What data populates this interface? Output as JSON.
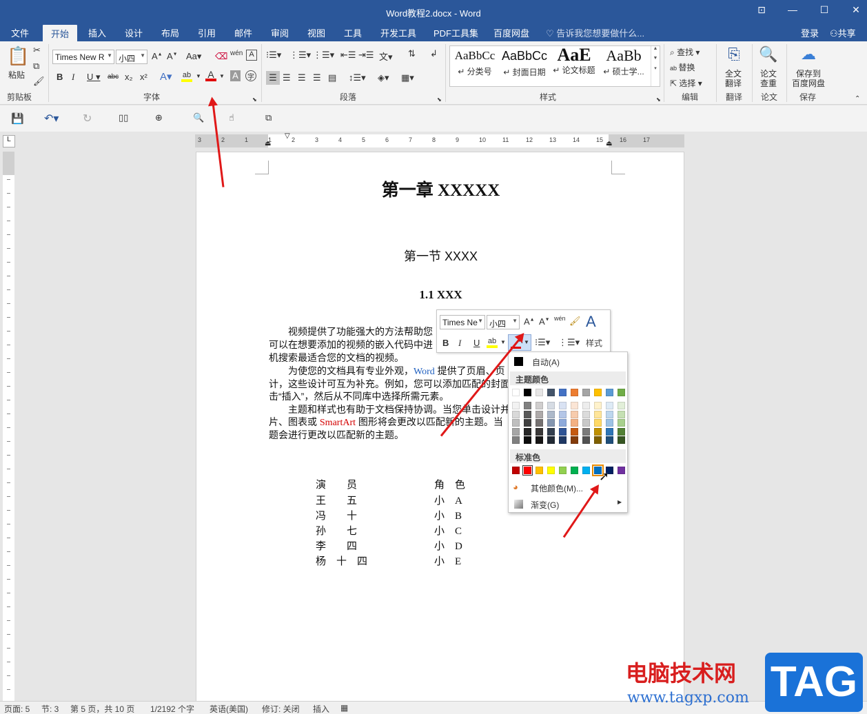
{
  "window": {
    "title": "Word教程2.docx - Word"
  },
  "tabs": [
    "文件",
    "开始",
    "插入",
    "设计",
    "布局",
    "引用",
    "邮件",
    "审阅",
    "视图",
    "工具",
    "开发工具",
    "PDF工具集",
    "百度网盘"
  ],
  "tell_me": "告诉我您想要做什么...",
  "account": {
    "login": "登录",
    "share": "共享"
  },
  "ribbon": {
    "clipboard": {
      "paste": "粘贴",
      "group": "剪贴板"
    },
    "font": {
      "name": "Times New R",
      "size": "小四",
      "group": "字体"
    },
    "paragraph": {
      "group": "段落"
    },
    "styles": {
      "group": "样式",
      "items": [
        {
          "preview": "AaBbCc",
          "label": "↵ 分类号"
        },
        {
          "preview": "AaBbCc",
          "label": "↵ 封面日期"
        },
        {
          "preview": "AaE",
          "label": "↵ 论文标题"
        },
        {
          "preview": "AaBb",
          "label": "↵ 硕士学..."
        }
      ]
    },
    "editing": {
      "find": "查找",
      "replace": "替换",
      "select": "选择",
      "group": "编辑"
    },
    "translate": {
      "btn1": "全文",
      "btn2": "翻译",
      "group": "翻译"
    },
    "paper": {
      "btn1": "论文",
      "btn2": "查重",
      "group": "论文"
    },
    "save": {
      "btn1": "保存到",
      "btn2": "百度网盘",
      "group": "保存"
    }
  },
  "ruler_numbers": [
    "3",
    "2",
    "1",
    "1",
    "2",
    "3",
    "4",
    "5",
    "6",
    "7",
    "8",
    "9",
    "10",
    "11",
    "12",
    "13",
    "14",
    "15",
    "16",
    "17"
  ],
  "document": {
    "chapter": "第一章  XXXXX",
    "section": "第一节  XXXX",
    "subsection": "1.1 XXX",
    "p1": [
      "视频提供了功能强大的方法帮助您",
      "可以在想要添加的视频的嵌入代码中进",
      "机搜索最适合您的文档的视频。"
    ],
    "p2_line1_a": "为使您的文档具有专业外观，",
    "p2_word": "Word",
    "p2_line1_b": " 提供了页眉、页",
    "p2_line2": "计，这些设计可互为补充。例如，您可以添加匹配的封面",
    "p2_line3": "击“插入”，然后从不同库中选择所需元素。",
    "p3_line1": "主题和样式也有助于文档保持协调。当您单击设计并",
    "p3_line2_a": "片、图表或 ",
    "p3_smartart": "SmartArt",
    "p3_line2_b": " 图形将会更改以匹配新的主题。当",
    "p3_line3": "题会进行更改以匹配新的主题。",
    "table": {
      "headers": [
        "演　　员",
        "角　色"
      ],
      "rows": [
        [
          "王　　五",
          "小　A"
        ],
        [
          "冯　　十",
          "小　B"
        ],
        [
          "孙　　七",
          "小　C"
        ],
        [
          "李　　四",
          "小　D"
        ],
        [
          "杨　十　四",
          "小　E"
        ]
      ]
    }
  },
  "mini_toolbar": {
    "font": "Times Ne",
    "size": "小四",
    "styles_label": "样式"
  },
  "color_menu": {
    "auto": "自动(A)",
    "theme_header": "主题颜色",
    "standard_header": "标准色",
    "more": "其他颜色(M)...",
    "gradient": "渐变(G)",
    "theme_top": [
      "#ffffff",
      "#000000",
      "#e7e6e6",
      "#44546a",
      "#4472c4",
      "#ed7d31",
      "#a5a5a5",
      "#ffc000",
      "#5b9bd5",
      "#70ad47"
    ],
    "theme_shades": [
      [
        "#f2f2f2",
        "#d9d9d9",
        "#bfbfbf",
        "#a6a6a6",
        "#808080"
      ],
      [
        "#808080",
        "#595959",
        "#404040",
        "#262626",
        "#0d0d0d"
      ],
      [
        "#d0cece",
        "#aeaaaa",
        "#757171",
        "#3a3838",
        "#171616"
      ],
      [
        "#d6dce4",
        "#adb9ca",
        "#8496b0",
        "#333f4f",
        "#222a35"
      ],
      [
        "#d9e2f3",
        "#b4c6e7",
        "#8eaadb",
        "#2f5496",
        "#1f3864"
      ],
      [
        "#fbe5d5",
        "#f7cbac",
        "#f4b183",
        "#c55a11",
        "#833c0b"
      ],
      [
        "#ededed",
        "#dbdbdb",
        "#c9c9c9",
        "#7b7b7b",
        "#525252"
      ],
      [
        "#fff2cc",
        "#ffe599",
        "#ffd965",
        "#bf9000",
        "#7f6000"
      ],
      [
        "#deebf6",
        "#bdd7ee",
        "#9dc3e5",
        "#2e75b5",
        "#1f4e79"
      ],
      [
        "#e2efd9",
        "#c5e0b3",
        "#a8d08d",
        "#538135",
        "#375623"
      ]
    ],
    "standard": [
      "#c00000",
      "#ff0000",
      "#ffc000",
      "#ffff00",
      "#92d050",
      "#00b050",
      "#00b0f0",
      "#0070c0",
      "#002060",
      "#7030a0"
    ]
  },
  "status": {
    "page": "页面: 5",
    "section": "节: 3",
    "pages": "第 5 页，共 10 页",
    "words": "1/2192 个字",
    "lang": "英语(美国)",
    "track": "修订: 关闭",
    "insert": "插入"
  },
  "watermark": {
    "text": "电脑技术网",
    "url": "www.tagxp.com",
    "logo": "TAG"
  },
  "colors": {
    "brand": "#2b579a",
    "arrow": "#e01818",
    "font_color_bar": "#e00000",
    "word_blue": "#1f5fbf",
    "smartart_red": "#d40000"
  }
}
